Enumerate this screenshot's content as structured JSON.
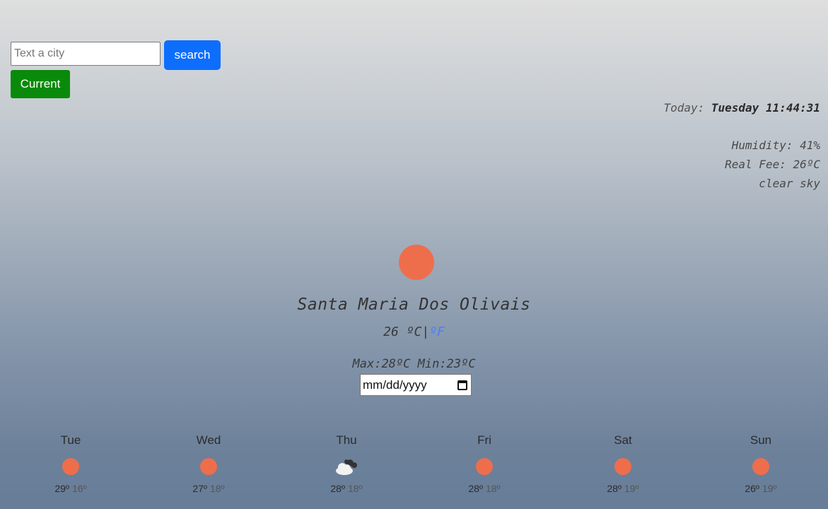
{
  "search": {
    "placeholder": "Text a city",
    "value": "",
    "search_label": "search",
    "current_label": "Current"
  },
  "info": {
    "today_label": "Today:",
    "today_value": "Tuesday 11:44:31",
    "humidity": "Humidity: 41%",
    "real_feel": "Real Fee: 26ºC",
    "description": "clear sky"
  },
  "main": {
    "icon": "sun-icon",
    "city": "Santa Maria Dos Olivais",
    "temperature": "26",
    "unit_c": "ºC",
    "separator": "|",
    "unit_f": "ºF",
    "max_min": "Max:28ºC Min:23ºC",
    "date_placeholder": "mm/dd/yyyy"
  },
  "colors": {
    "sun": "#ee6e4c",
    "search_button": "#0d6efd",
    "current_button": "#0a8a0a",
    "fahrenheit_link": "#4d7ff0"
  },
  "forecast": [
    {
      "day": "Tue",
      "icon": "sun-icon",
      "max": "29º",
      "min": "16º"
    },
    {
      "day": "Wed",
      "icon": "sun-icon",
      "max": "27º",
      "min": "18º"
    },
    {
      "day": "Thu",
      "icon": "cloud-icon",
      "max": "28º",
      "min": "18º"
    },
    {
      "day": "Fri",
      "icon": "sun-icon",
      "max": "28º",
      "min": "18º"
    },
    {
      "day": "Sat",
      "icon": "sun-icon",
      "max": "28º",
      "min": "19º"
    },
    {
      "day": "Sun",
      "icon": "sun-icon",
      "max": "26º",
      "min": "19º"
    }
  ]
}
